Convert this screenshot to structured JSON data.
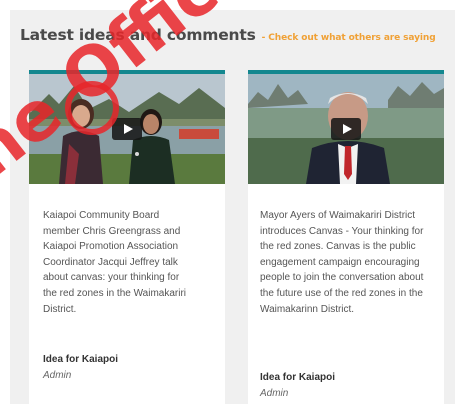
{
  "header": {
    "title": "Latest ideas and comments",
    "subtitle": "- Check out what others are saying"
  },
  "cards": [
    {
      "description": "Kaiapoi Community Board member Chris Greengrass and Kaiapoi Promotion Association Coordinator Jacqui Jeffrey talk about canvas: your thinking for the red zones in the Waimakariri District.",
      "idea_label": "Idea for Kaiapoi",
      "author": "Admin"
    },
    {
      "description": "Mayor Ayers of Waimakariri District introduces Canvas - Your thinking for the red zones. Canvas is the public engagement campaign encouraging people to join the conversation about the future use of the red zones in the Waimakarinn District.",
      "idea_label": "Idea for Kaiapoi",
      "author": "Admin"
    }
  ],
  "watermark_text": "ne Officia",
  "colors": {
    "accent_teal": "#13878f",
    "subtitle_orange": "#f0a136",
    "watermark_red": "#e8262a"
  }
}
